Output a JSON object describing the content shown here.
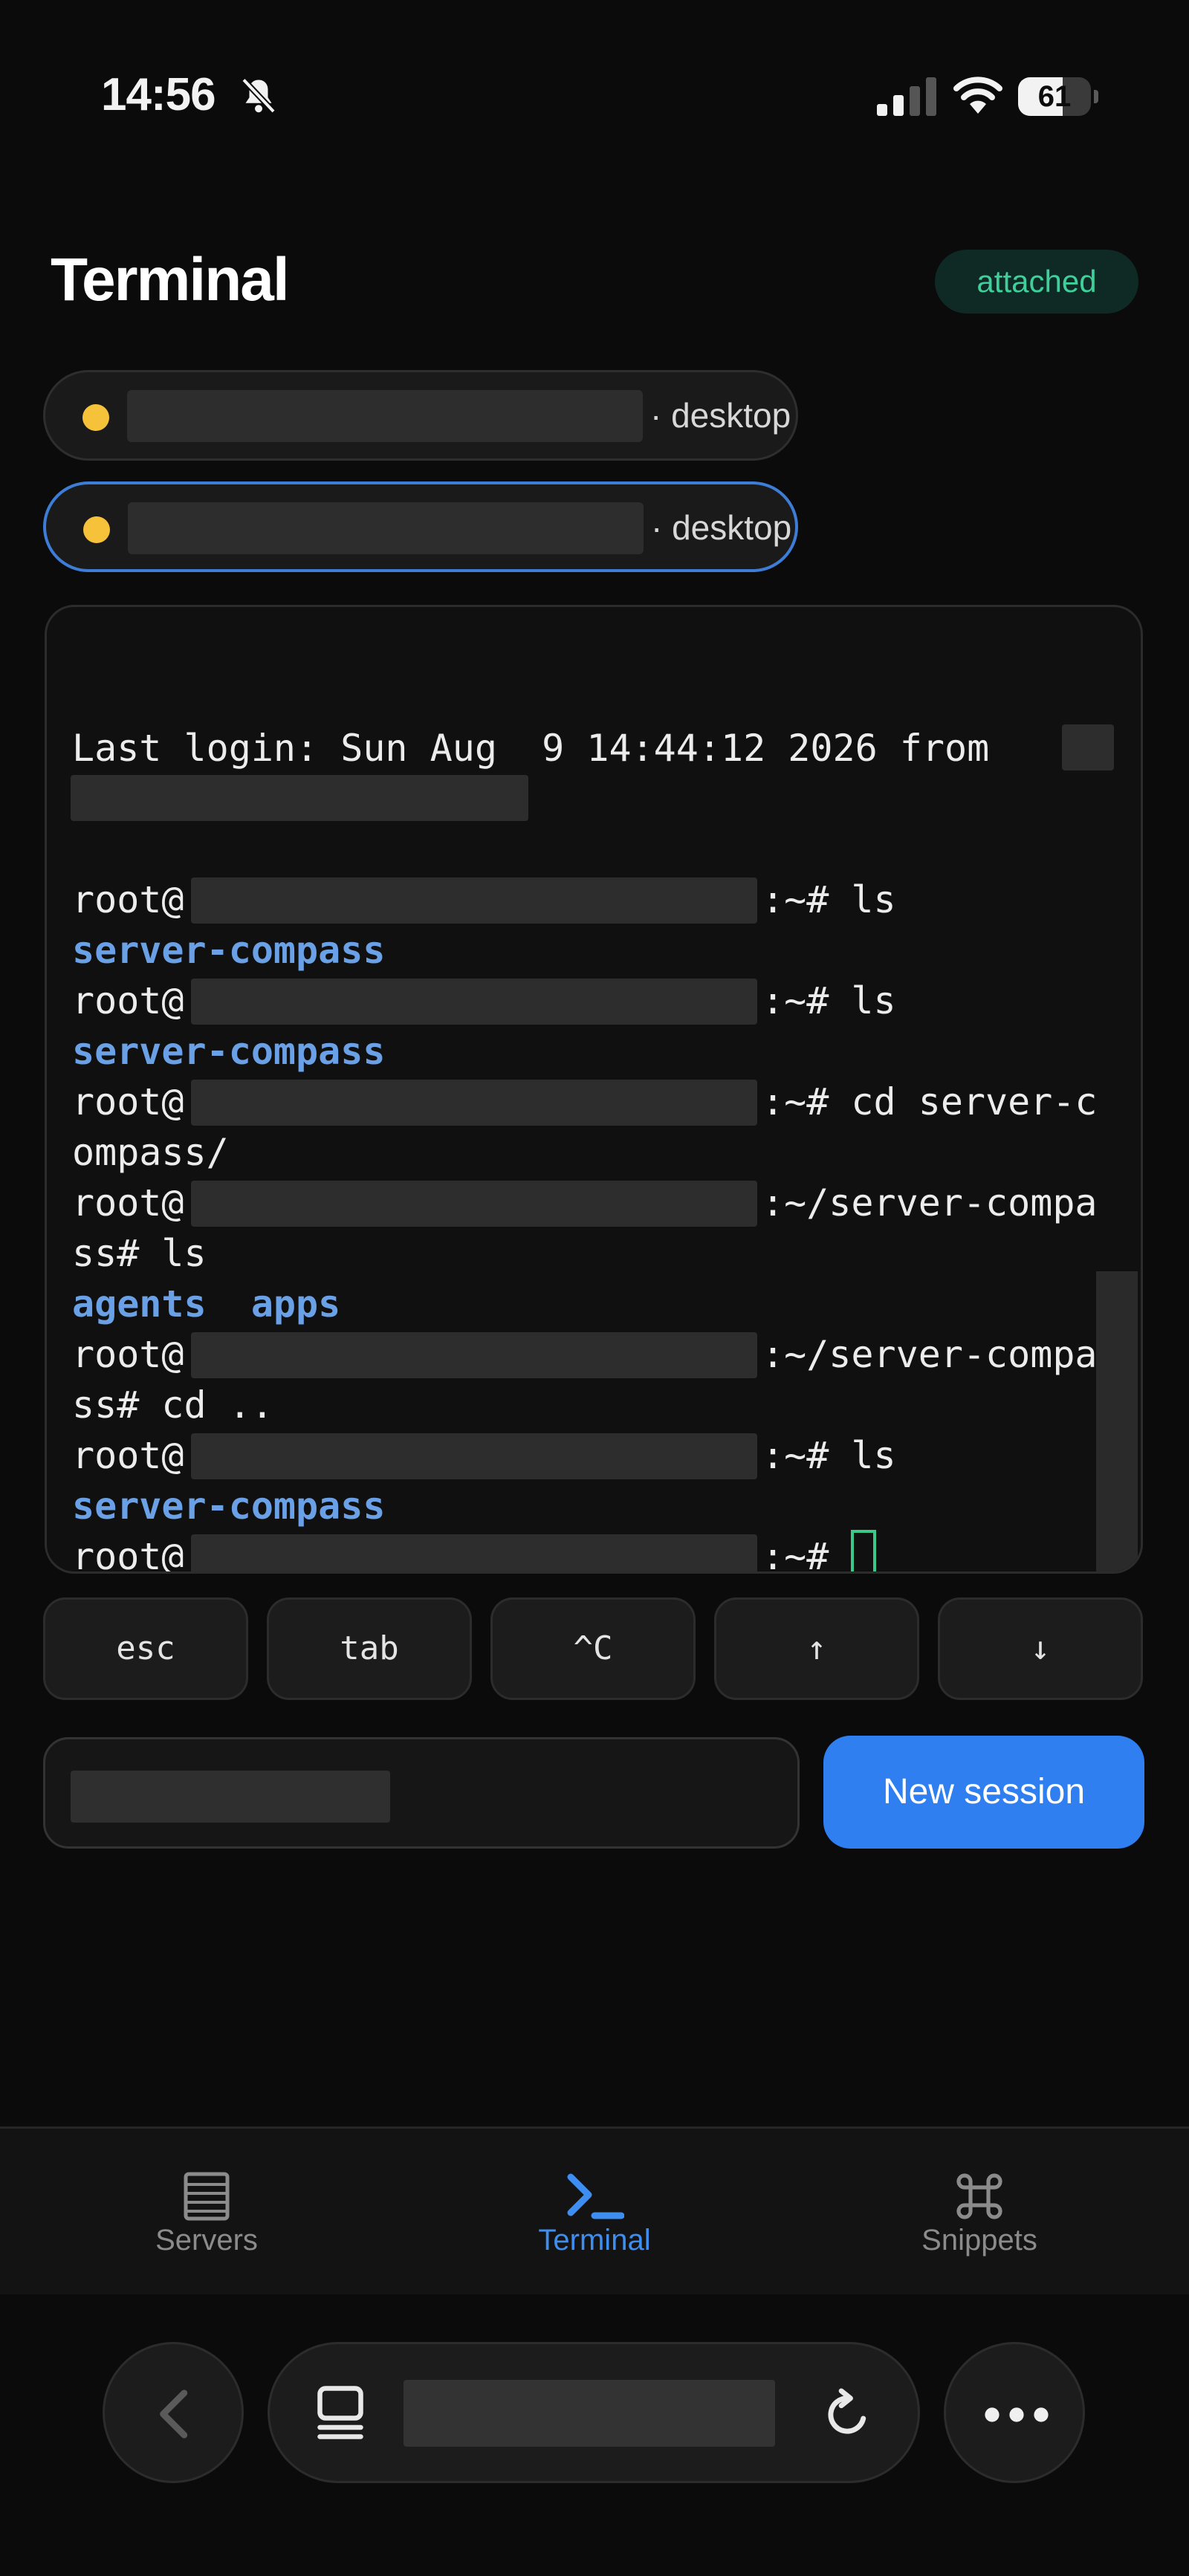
{
  "status_bar": {
    "time": "14:56",
    "battery": "61",
    "battery_level": 0.61
  },
  "header": {
    "title": "Terminal",
    "badge": "attached"
  },
  "sessions": [
    {
      "host": "· desktop",
      "active": false
    },
    {
      "host": "· desktop",
      "active": true
    }
  ],
  "terminal": {
    "lines": [
      {
        "text": "Last login: Sun Aug  9 14:44:12 2026 from"
      },
      {
        "text": "root@"
      },
      {
        "suffix": ":~# ls"
      },
      {
        "text": "server-compass"
      },
      {
        "text": "root@"
      },
      {
        "suffix": ":~# ls"
      },
      {
        "text": "server-compass"
      },
      {
        "text": "root@"
      },
      {
        "suffix": ":~# cd server-c"
      },
      {
        "text": "ompass/"
      },
      {
        "text": "root@"
      },
      {
        "suffix": ":~/server-compa"
      },
      {
        "text": "ss# ls"
      },
      {
        "text": "agents  apps"
      },
      {
        "text": "root@"
      },
      {
        "suffix": ":~/server-compa"
      },
      {
        "text": "ss# cd .."
      },
      {
        "text": "root@"
      },
      {
        "suffix": ":~# ls"
      },
      {
        "text": "server-compass"
      },
      {
        "text": "root@"
      },
      {
        "suffix": ":~#"
      }
    ]
  },
  "keys": [
    "esc",
    "tab",
    "^C",
    "↑",
    "↓"
  ],
  "input": {
    "new_session_label": "New session"
  },
  "tabs": [
    {
      "label": "Servers",
      "icon": "server-list-icon"
    },
    {
      "label": "Terminal",
      "icon": "terminal-prompt-icon"
    },
    {
      "label": "Snippets",
      "icon": "command-key-icon"
    }
  ],
  "colors": {
    "accent": "#2f7ff0",
    "badge_text": "#3fcf9b",
    "session_dot": "#f6c23a",
    "terminal_blue": "#6aa0e6"
  }
}
